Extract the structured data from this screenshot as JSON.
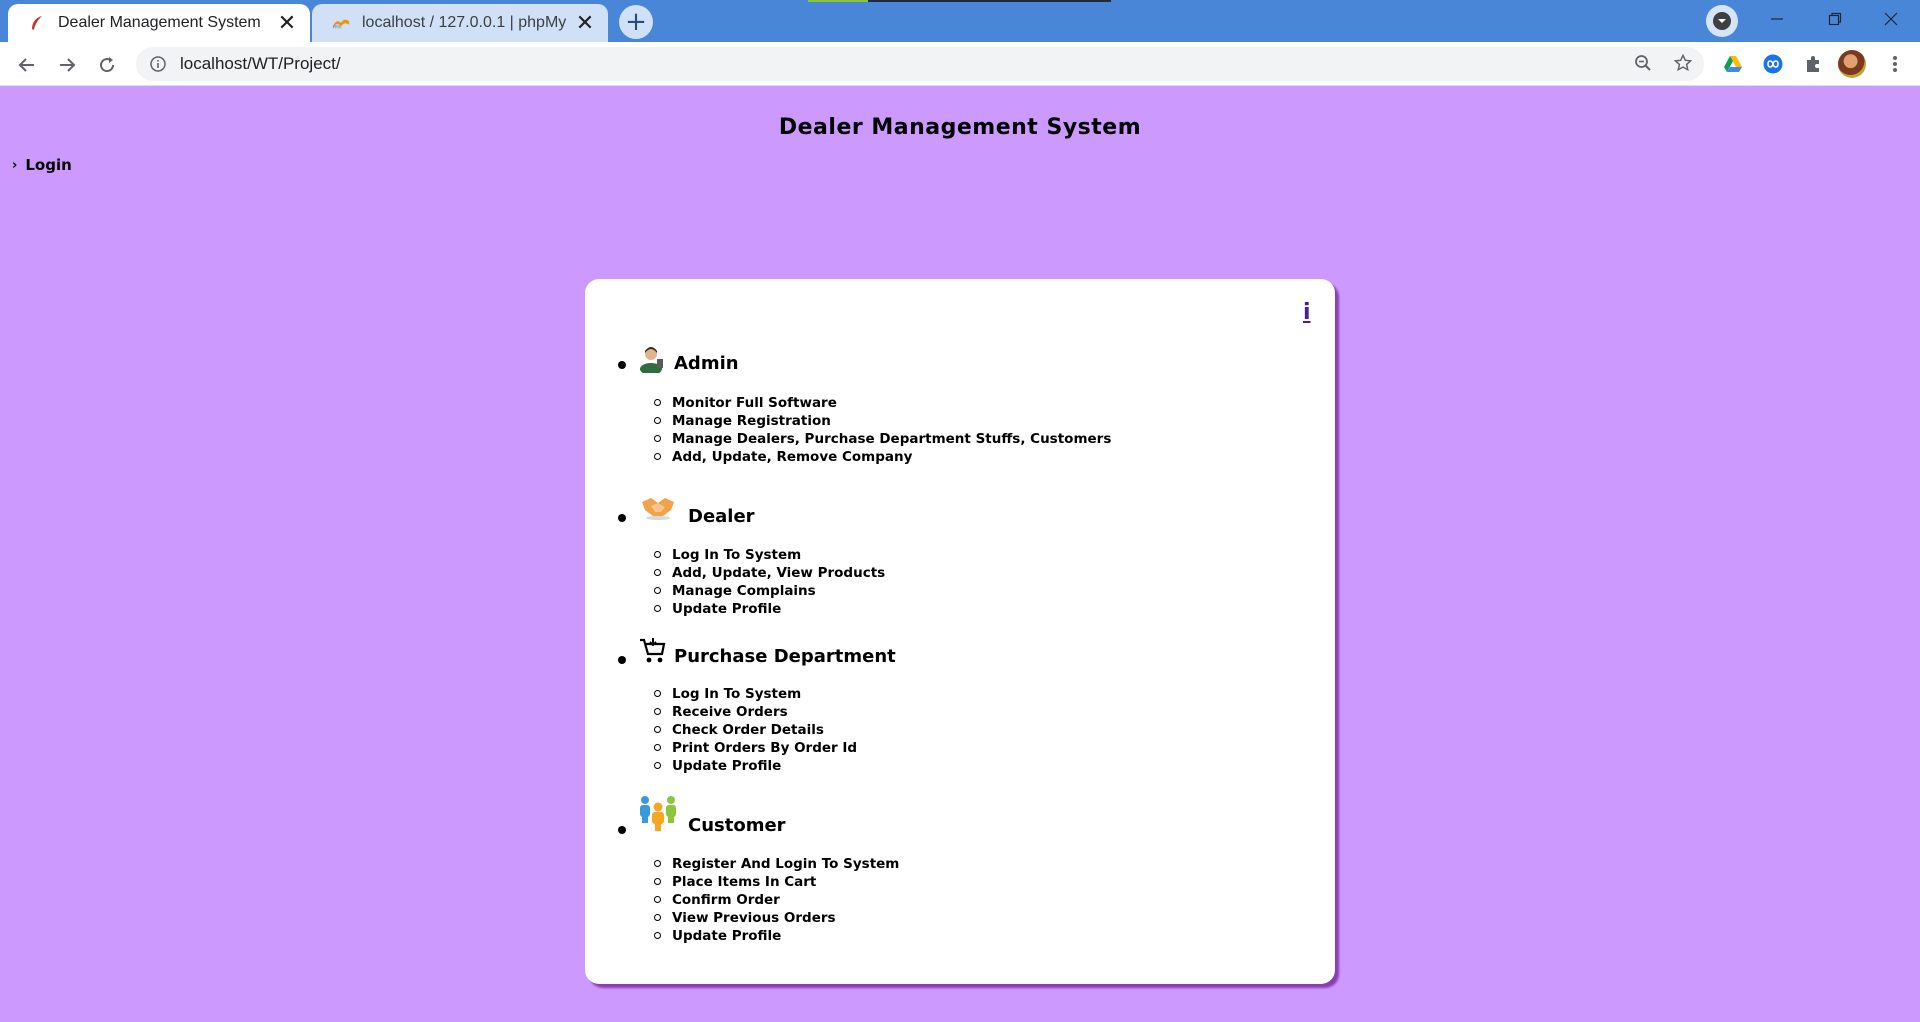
{
  "browser": {
    "tabs": [
      {
        "title": "Dealer Management System",
        "active": true
      },
      {
        "title": "localhost / 127.0.0.1 | phpMyAdmin",
        "active": false
      }
    ],
    "address_bar": {
      "url": "localhost/WT/Project/"
    },
    "colors": {
      "tabbar": "#4a86d8",
      "page_background": "#cc99ff"
    }
  },
  "page": {
    "title": "Dealer Management System",
    "login_label": "Login",
    "info_link": "i",
    "roles": [
      {
        "name": "Admin",
        "icon": "admin-person-icon",
        "items": [
          "Monitor Full Software",
          "Manage Registration",
          "Manage Dealers, Purchase Department Stuffs, Customers",
          "Add, Update, Remove Company"
        ]
      },
      {
        "name": "Dealer",
        "icon": "handshake-icon",
        "items": [
          "Log In To System",
          "Add, Update, View Products",
          "Manage Complains",
          "Update Profile"
        ]
      },
      {
        "name": "Purchase Department",
        "icon": "cart-icon",
        "items": [
          "Log In To System",
          "Receive Orders",
          "Check Order Details",
          "Print Orders By Order Id",
          "Update Profile"
        ]
      },
      {
        "name": "Customer",
        "icon": "people-group-icon",
        "items": [
          "Register And Login To System",
          "Place Items In Cart",
          "Confirm Order",
          "View Previous Orders",
          "Update Profile"
        ]
      }
    ]
  }
}
